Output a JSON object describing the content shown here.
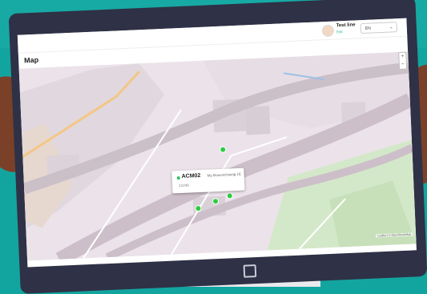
{
  "header": {
    "user_name": "Test line",
    "user_role": "Edit",
    "language": "EN"
  },
  "page": {
    "title": "Map"
  },
  "map": {
    "popup": {
      "code": "ACM02",
      "address": "My Braunschweig 1E",
      "sub": "12249"
    },
    "zoom_in": "+",
    "zoom_out": "−",
    "attribution": "Leaflet | © OpenStreetMap"
  },
  "colors": {
    "marker": "#2ecc40",
    "accent": "#35b6a6",
    "frame": "#2f3146",
    "background": "#12a5a0"
  }
}
